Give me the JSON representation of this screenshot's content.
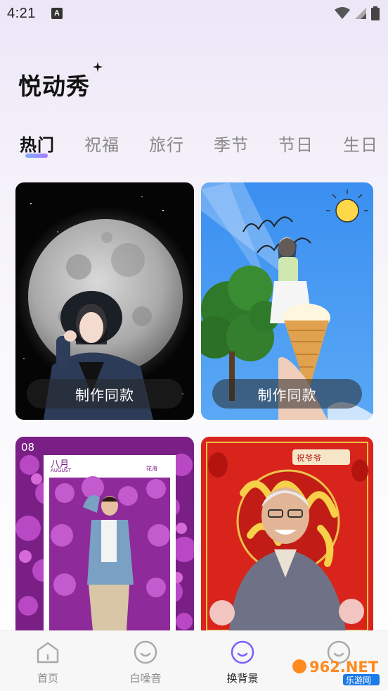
{
  "status_bar": {
    "time": "4:21",
    "notification_glyph": "A"
  },
  "app": {
    "title": "悦动秀"
  },
  "tabs": [
    {
      "label": "热门",
      "active": true
    },
    {
      "label": "祝福",
      "active": false
    },
    {
      "label": "旅行",
      "active": false
    },
    {
      "label": "季节",
      "active": false
    },
    {
      "label": "节日",
      "active": false
    },
    {
      "label": "生日",
      "active": false
    }
  ],
  "cards": [
    {
      "button_label": "制作同款",
      "theme": "moon-night"
    },
    {
      "button_label": "制作同款",
      "theme": "summer-icecream"
    },
    {
      "overlay_month": "八月",
      "overlay_en": "AUGUST",
      "overlay_num": "08",
      "overlay_tag": "花海",
      "theme": "flower-sea"
    },
    {
      "overlay_badge": "祝爷爷",
      "theme": "grandpa-blessing"
    }
  ],
  "bottom_nav": [
    {
      "label": "首页",
      "icon": "home-icon",
      "active": false
    },
    {
      "label": "白噪音",
      "icon": "smile-icon",
      "active": false
    },
    {
      "label": "换背景",
      "icon": "smile-icon",
      "active": true
    },
    {
      "label": "",
      "icon": "smile-icon",
      "active": false
    }
  ],
  "watermark": {
    "text": "962.NET",
    "sub": "乐游网"
  },
  "colors": {
    "accent": "#7b5cff",
    "tab_inactive": "#8a8a8a"
  }
}
